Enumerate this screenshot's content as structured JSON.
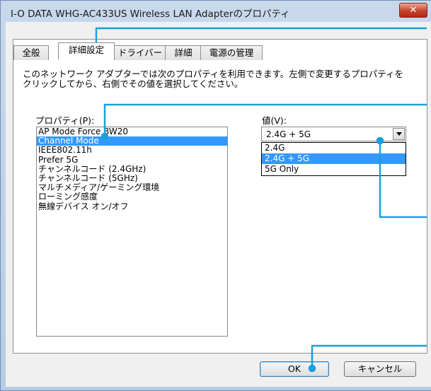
{
  "window": {
    "title": "I-O DATA WHG-AC433US Wireless LAN Adapterのプロパティ",
    "close_glyph": "✕"
  },
  "tabs": [
    {
      "label": "全般"
    },
    {
      "label": "詳細設定",
      "active": true
    },
    {
      "label": "ドライバー"
    },
    {
      "label": "詳細"
    },
    {
      "label": "電源の管理"
    }
  ],
  "panel": {
    "description_line1": "このネットワーク アダプターでは次のプロパティを利用できます。左側で変更するプロパティを",
    "description_line2": "クリックしてから、右側でその値を選択してください。",
    "property_label": "プロパティ(P):",
    "value_label": "値(V):",
    "properties": [
      "AP Mode Force BW20",
      "Channel Mode",
      "IEEE802.11h",
      "Prefer 5G",
      "チャンネルコード (2.4GHz)",
      "チャンネルコード (5GHz)",
      "マルチメディア/ゲーミング環境",
      "ローミング感度",
      "無線デバイス オン/オフ"
    ],
    "selected_property": "Channel Mode",
    "value_current": "2.4G + 5G",
    "value_options": [
      "2.4G",
      "2.4G + 5G",
      "5G Only"
    ],
    "selected_value": "2.4G + 5G"
  },
  "buttons": {
    "ok": "OK",
    "cancel": "キャンセル"
  },
  "colors": {
    "accent_callout": "#1aa0dc",
    "selection": "#3399ff",
    "close_button": "#c7412a"
  }
}
